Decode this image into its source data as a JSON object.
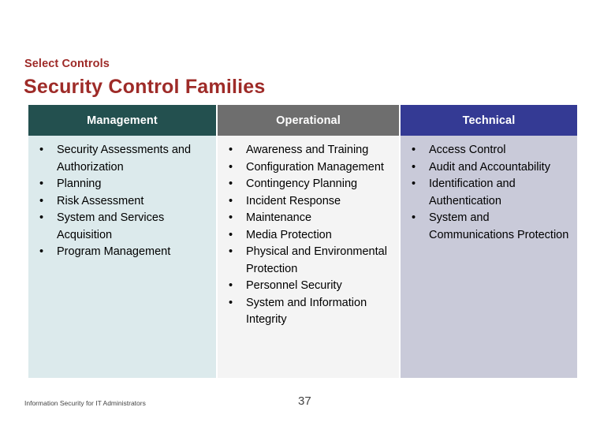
{
  "slide": {
    "eyebrow": "Select Controls",
    "title": "Security Control Families"
  },
  "table": {
    "columns": [
      {
        "header": "Management",
        "header_color": "#23504F",
        "body_color": "#DCEAEC",
        "items": [
          "Security Assessments and Authorization",
          "Planning",
          "Risk Assessment",
          "System and Services Acquisition",
          "Program Management"
        ]
      },
      {
        "header": "Operational",
        "header_color": "#6E6E6E",
        "body_color": "#F4F4F4",
        "items": [
          "Awareness and Training",
          "Configuration Management",
          "Contingency Planning",
          "Incident Response",
          "Maintenance",
          "Media Protection",
          "Physical and Environmental Protection",
          "Personnel Security",
          "System and Information Integrity"
        ]
      },
      {
        "header": "Technical",
        "header_color": "#343A94",
        "body_color": "#C9CAD9",
        "items": [
          "Access Control",
          "Audit and Accountability",
          "Identification and Authentication",
          "System and Communications Protection"
        ]
      }
    ]
  },
  "footer": {
    "text": "Information Security for IT Administrators",
    "page_number": "37"
  },
  "colors": {
    "accent_red": "#9E2B28",
    "text": "#000000"
  }
}
